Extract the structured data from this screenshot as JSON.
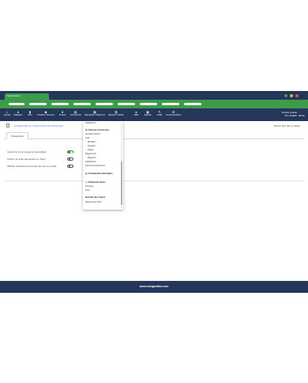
{
  "browser": {
    "tab_label": "NextGestion"
  },
  "menu": {
    "items": [
      {
        "label": "Accueil",
        "icon": "home-icon"
      },
      {
        "label": "Utilisateur",
        "icon": "user-icon"
      },
      {
        "label": "Tiers",
        "icon": "building-icon"
      },
      {
        "label": "Produits / Services",
        "icon": "cube-icon"
      },
      {
        "label": "Projets",
        "icon": "sitemap-icon"
      },
      {
        "label": "Commercial",
        "icon": "cart-icon"
      },
      {
        "label": "Facturation / Paiement",
        "icon": "invoice-icon"
      },
      {
        "label": "Banque / Caisse",
        "icon": "bank-icon"
      },
      {
        "label": "GRH",
        "icon": "people-icon"
      },
      {
        "label": "Agenda",
        "icon": "calendar-icon"
      },
      {
        "label": "Outils",
        "icon": "wrench-icon"
      },
      {
        "label": "Communications",
        "icon": "comments-icon"
      }
    ],
    "company": "Société modèle",
    "lang": "FR / English",
    "user": "admin"
  },
  "page": {
    "title": "Configuration du module Menu 3C Responsive",
    "back_link": "Retour liste des modules",
    "tab": "Paramètres"
  },
  "options": [
    {
      "label": "Cacher le menu à gauche de Dolibarr",
      "on": true
    },
    {
      "label": "Cacher de suite (au-dessus en haut)",
      "on": false
    },
    {
      "label": "Afficher seulement les icônes du menu en haut",
      "on": false
    }
  ],
  "dropdown": {
    "items": [
      {
        "kind": "item",
        "text": "Statistiques"
      },
      {
        "kind": "header",
        "text": "Factures fournisseur"
      },
      {
        "kind": "item",
        "text": "Nouvelle facture"
      },
      {
        "kind": "item",
        "text": "Liste"
      },
      {
        "kind": "sub",
        "text": "Brouillon"
      },
      {
        "kind": "sub",
        "text": "Impayée"
      },
      {
        "kind": "sub",
        "text": "Payée"
      },
      {
        "kind": "item",
        "text": "Règlements"
      },
      {
        "kind": "sub",
        "text": "Rapports"
      },
      {
        "kind": "item",
        "text": "Statistiques"
      },
      {
        "kind": "item",
        "text": "Factures fournisseurs"
      },
      {
        "kind": "header",
        "text": "Commandes facturables"
      },
      {
        "kind": "header",
        "text": "Paiements divers"
      },
      {
        "kind": "item",
        "text": "Nouveau"
      },
      {
        "kind": "item",
        "text": "Liste"
      },
      {
        "kind": "header",
        "text": "Bouclier des clients"
      },
      {
        "kind": "item",
        "text": "Règlements client"
      }
    ]
  },
  "footer": {
    "text": "www.nextgestion.com"
  },
  "colors": {
    "navy": "#24375a",
    "green": "#3d9c49",
    "link": "#3b77b5"
  }
}
